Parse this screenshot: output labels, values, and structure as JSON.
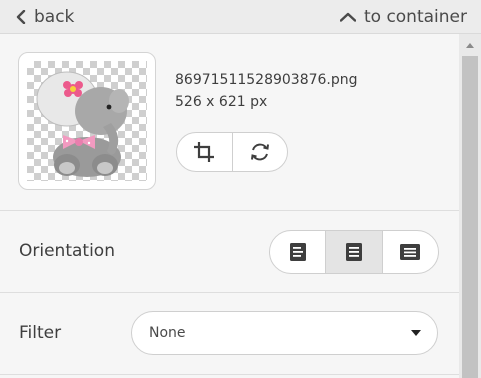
{
  "nav": {
    "back_label": "back",
    "container_label": "to container"
  },
  "image": {
    "file_name": "86971511528903876.png",
    "dimensions": "526 x 621 px"
  },
  "actions": {
    "crop_icon": "crop-icon",
    "replace_icon": "refresh-icon"
  },
  "orientation": {
    "label": "Orientation",
    "options": [
      "align-left-icon",
      "align-center-icon",
      "align-right-icon"
    ],
    "selected_index": 1
  },
  "filter": {
    "label": "Filter",
    "value": "None"
  },
  "colors": {
    "accent_pink": "#ec5a8c",
    "selected_segment": "#e4e4e4"
  }
}
